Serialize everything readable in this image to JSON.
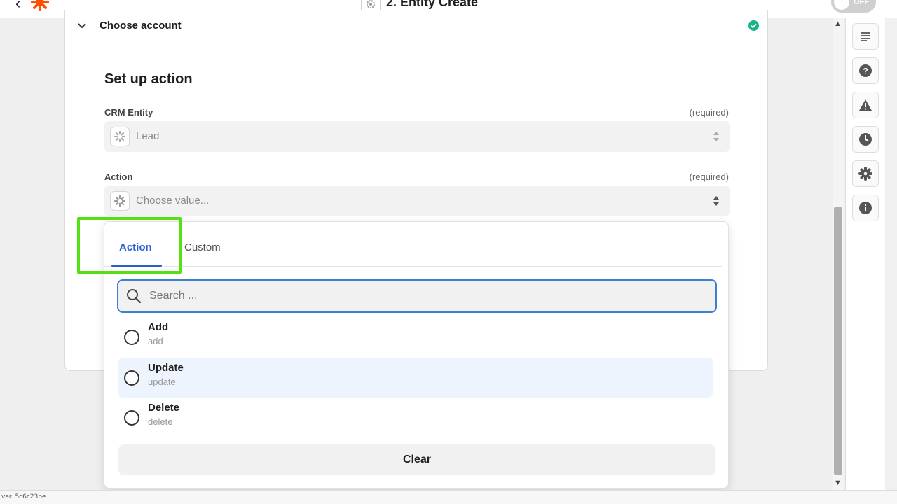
{
  "topbar": {
    "title": "2. Entity Create",
    "toggle_label": "OFF"
  },
  "card": {
    "header_title": "Choose account",
    "section_title": "Set up action",
    "fields": [
      {
        "label": "CRM Entity",
        "required": "(required)",
        "value": "Lead"
      },
      {
        "label": "Action",
        "required": "(required)",
        "placeholder": "Choose value..."
      }
    ]
  },
  "dropdown": {
    "tabs": [
      {
        "label": "Action",
        "active": true
      },
      {
        "label": "Custom",
        "active": false
      }
    ],
    "search_placeholder": "Search ...",
    "options": [
      {
        "title": "Add",
        "subtitle": "add"
      },
      {
        "title": "Update",
        "subtitle": "update"
      },
      {
        "title": "Delete",
        "subtitle": "delete"
      }
    ],
    "clear_label": "Clear"
  },
  "sidebar": {
    "icons": [
      "list-icon",
      "help-icon",
      "warning-icon",
      "clock-icon",
      "settings-icon",
      "info-icon"
    ]
  },
  "statusbar": {
    "version": "ver. 5c6c23be"
  },
  "colors": {
    "accent": "#2a5ed6",
    "highlight": "#55e014",
    "success": "#1bb38e",
    "brand": "#ff4f00"
  }
}
